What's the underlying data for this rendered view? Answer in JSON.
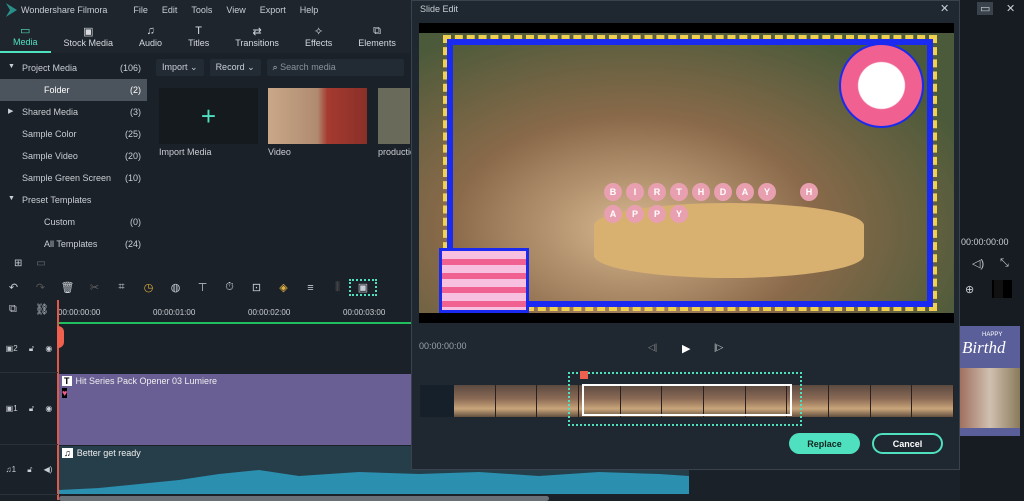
{
  "app": {
    "title": "Wondershare Filmora",
    "menu": [
      "File",
      "Edit",
      "Tools",
      "View",
      "Export",
      "Help"
    ]
  },
  "tabs": [
    {
      "label": "Media",
      "icon": "folder-icon"
    },
    {
      "label": "Stock Media",
      "icon": "stock-icon"
    },
    {
      "label": "Audio",
      "icon": "music-icon"
    },
    {
      "label": "Titles",
      "icon": "text-icon"
    },
    {
      "label": "Transitions",
      "icon": "transition-icon"
    },
    {
      "label": "Effects",
      "icon": "effects-icon"
    },
    {
      "label": "Elements",
      "icon": "elements-icon"
    }
  ],
  "sidebar": [
    {
      "label": "Project Media",
      "count": "(106)",
      "arrow": "▼"
    },
    {
      "label": "Folder",
      "count": "(2)",
      "arrow": ""
    },
    {
      "label": "Shared Media",
      "count": "(3)",
      "arrow": "▶"
    },
    {
      "label": "Sample Color",
      "count": "(25)",
      "arrow": ""
    },
    {
      "label": "Sample Video",
      "count": "(20)",
      "arrow": ""
    },
    {
      "label": "Sample Green Screen",
      "count": "(10)",
      "arrow": ""
    },
    {
      "label": "Preset Templates",
      "count": "",
      "arrow": "▼"
    },
    {
      "label": "Custom",
      "count": "(0)",
      "arrow": ""
    },
    {
      "label": "All Templates",
      "count": "(24)",
      "arrow": ""
    }
  ],
  "media": {
    "import": "Import",
    "record": "Record",
    "search_placeholder": "Search media",
    "items": [
      "Import Media",
      "Video",
      "productio"
    ]
  },
  "timeline": {
    "ticks": [
      "00:00:00:00",
      "00:00:01:00",
      "00:00:02:00",
      "00:00:03:00"
    ],
    "tracks": [
      {
        "id": "2"
      },
      {
        "id": "1",
        "clip": "Hit Series Pack Opener 03 Lumiere"
      },
      {
        "id": "1",
        "clip": "Better get ready"
      }
    ]
  },
  "dialog": {
    "title": "Slide Edit",
    "timecode": "00:00:00:00",
    "replace": "Replace",
    "cancel": "Cancel",
    "cake_letters": [
      "B",
      "I",
      "R",
      "T",
      "H",
      "D",
      "A",
      "Y",
      "H",
      "A",
      "P",
      "P",
      "Y"
    ]
  },
  "right": {
    "timecode": "00:00:00:00",
    "thumb_text": "Birthd",
    "thumb_small": "HAPPY"
  },
  "colors": {
    "accent": "#4fe0c0",
    "clip": "#6a5f94",
    "audio": "#2b8fb0"
  }
}
